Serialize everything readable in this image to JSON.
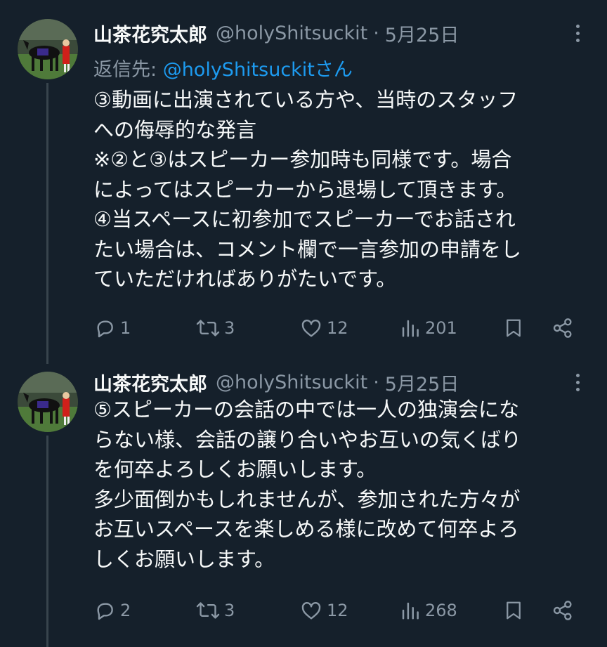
{
  "tweets": [
    {
      "display_name": "山茶花究太郎",
      "handle": "@holyShitsuckit",
      "separator": "·",
      "date": "5月25日",
      "reply_label": "返信先: ",
      "reply_mention": "@holyShitsuckitさん",
      "lines": [
        "③動画に出演されている方や、当時のスタッフ",
        "への侮辱的な発言",
        "※②と③はスピーカー参加時も同様です。場合",
        "によってはスピーカーから退場して頂きます。",
        "④当スペースに初参加でスピーカーでお話され",
        "たい場合は、コメント欄で一言参加の申請をし",
        "ていただければありがたいです。"
      ],
      "replies": "1",
      "retweets": "3",
      "likes": "12",
      "views": "201"
    },
    {
      "display_name": "山茶花究太郎",
      "handle": "@holyShitsuckit",
      "separator": "·",
      "date": "5月25日",
      "lines": [
        "⑤スピーカーの会話の中では一人の独演会にな",
        "らない様、会話の譲り合いやお互いの気くばり",
        "を何卒よろしくお願いします。",
        "多少面倒かもしれませんが、参加された方々が",
        "お互いスペースを楽しめる様に改めて何卒よろ",
        "しくお願いします。"
      ],
      "replies": "2",
      "retweets": "3",
      "likes": "12",
      "views": "268"
    }
  ],
  "icons": {
    "reply": "reply-icon",
    "retweet": "retweet-icon",
    "like": "heart-icon",
    "views": "analytics-icon",
    "bookmark": "bookmark-icon",
    "share": "share-icon",
    "more": "more-icon"
  },
  "colors": {
    "background": "#15202b",
    "text": "#f7f9f9",
    "muted": "#8b98a5",
    "link": "#1d9bf0",
    "thread_line": "#38444d"
  }
}
